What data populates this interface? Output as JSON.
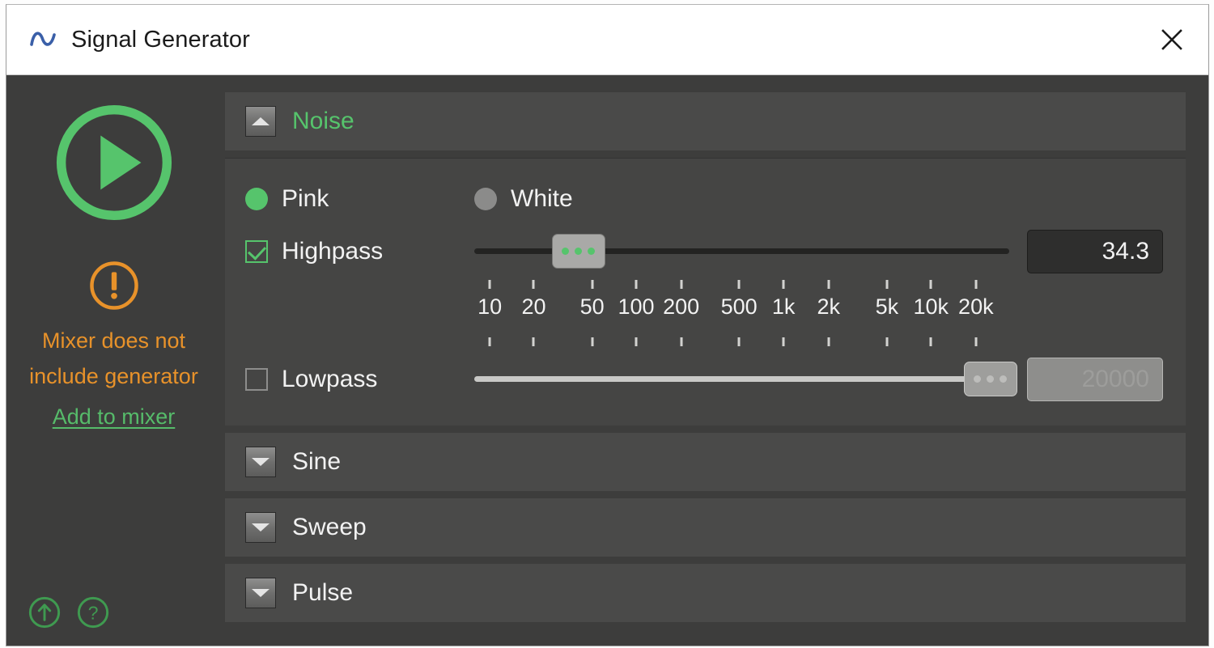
{
  "window": {
    "title": "Signal Generator",
    "title_icon": "sine-wave-icon",
    "close_icon": "close-icon"
  },
  "transport": {
    "play_icon": "play-circle-icon",
    "warning_icon": "warning-circle-icon",
    "warning_text": "Mixer does not include generator",
    "add_to_mixer_label": "Add to mixer",
    "upload_icon": "upload-circle-icon",
    "help_icon": "help-circle-icon"
  },
  "colors": {
    "accent_green": "#56c46c",
    "warning_orange": "#e8922a",
    "panel_bg": "#3d3d3c",
    "header_bg": "#4a4a49",
    "body_bg": "#454544"
  },
  "sections": [
    {
      "id": "noise",
      "label": "Noise",
      "expanded": true,
      "toggle_icon": "chevron-up-icon"
    },
    {
      "id": "sine",
      "label": "Sine",
      "expanded": false,
      "toggle_icon": "chevron-down-icon"
    },
    {
      "id": "sweep",
      "label": "Sweep",
      "expanded": false,
      "toggle_icon": "chevron-down-icon"
    },
    {
      "id": "pulse",
      "label": "Pulse",
      "expanded": false,
      "toggle_icon": "chevron-down-icon"
    }
  ],
  "noise": {
    "type_options": [
      {
        "label": "Pink",
        "selected": true
      },
      {
        "label": "White",
        "selected": false
      }
    ],
    "highpass": {
      "label": "Highpass",
      "checked": true,
      "value": "34.3",
      "slider_percent": 19.5,
      "enabled": true
    },
    "lowpass": {
      "label": "Lowpass",
      "checked": false,
      "value": "20000",
      "slider_percent": 96.5,
      "enabled": false
    },
    "scale_ticks": [
      {
        "label": "10",
        "pos": 3.0
      },
      {
        "label": "20",
        "pos": 11.5
      },
      {
        "label": "50",
        "pos": 22.8
      },
      {
        "label": "100",
        "pos": 31.3
      },
      {
        "label": "200",
        "pos": 40.0
      },
      {
        "label": "500",
        "pos": 51.2
      },
      {
        "label": "1k",
        "pos": 59.8
      },
      {
        "label": "2k",
        "pos": 68.5
      },
      {
        "label": "5k",
        "pos": 79.8
      },
      {
        "label": "10k",
        "pos": 88.3
      },
      {
        "label": "20k",
        "pos": 97.0
      }
    ]
  }
}
